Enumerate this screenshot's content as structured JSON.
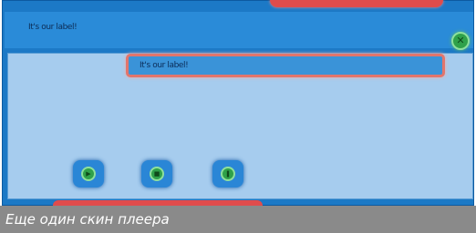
{
  "player": {
    "title": "It's our label!",
    "close_icon": "close-icon",
    "field_text": "It's our label!",
    "controls": [
      {
        "name": "play-button",
        "icon": "play-icon",
        "glyph": "▶"
      },
      {
        "name": "stop-button",
        "icon": "stop-icon",
        "glyph": "■"
      },
      {
        "name": "pause-button",
        "icon": "pause-icon",
        "glyph": "❚❚"
      }
    ]
  },
  "caption": "Еще один скин плеера",
  "colors": {
    "skin_blue": "#1c79c6",
    "panel_blue": "#a6ccee",
    "accent_red": "#e04c4c",
    "button_green": "#2fa14a"
  }
}
